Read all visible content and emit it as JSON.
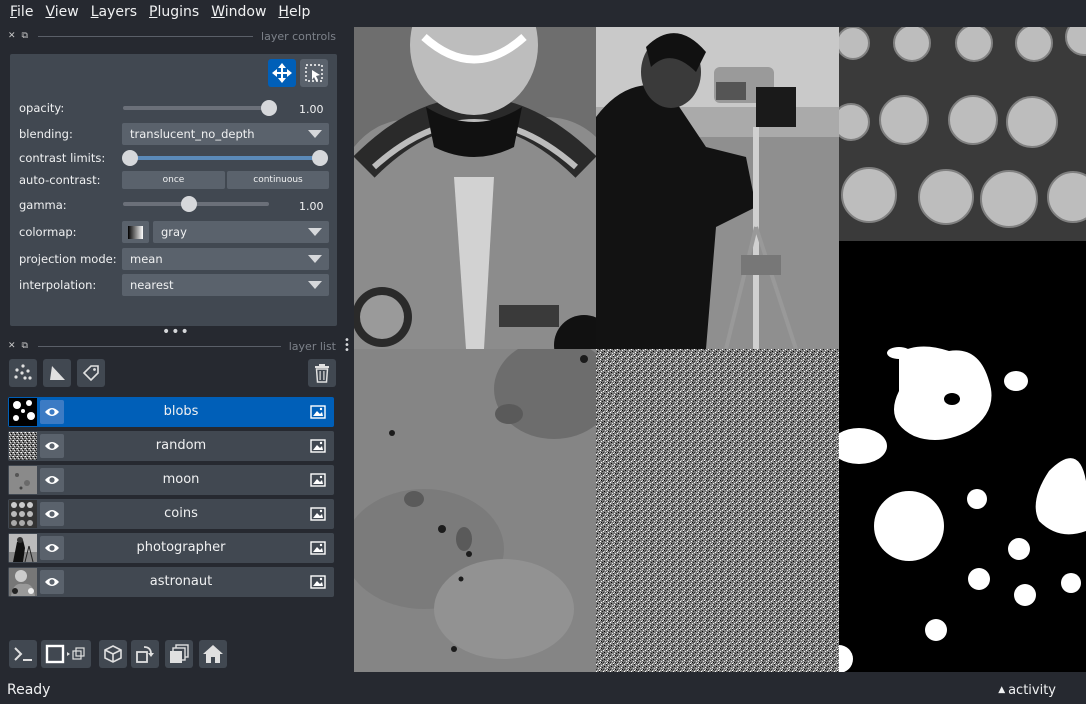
{
  "menu": [
    {
      "label": "File",
      "mnemonic": "F",
      "rest": "ile"
    },
    {
      "label": "View",
      "mnemonic": "V",
      "rest": "iew"
    },
    {
      "label": "Layers",
      "mnemonic": "L",
      "rest": "ayers"
    },
    {
      "label": "Plugins",
      "mnemonic": "P",
      "rest": "lugins"
    },
    {
      "label": "Window",
      "mnemonic": "W",
      "rest": "indow"
    },
    {
      "label": "Help",
      "mnemonic": "H",
      "rest": "elp"
    }
  ],
  "layer_controls": {
    "title": "layer controls",
    "opacity_label": "opacity:",
    "opacity_value": "1.00",
    "opacity_fraction": 1.0,
    "blending_label": "blending:",
    "blending_value": "translucent_no_depth",
    "contrast_label": "contrast limits:",
    "contrast_range": [
      0.0,
      1.0
    ],
    "auto_contrast_label": "auto-contrast:",
    "once_label": "once",
    "continuous_label": "continuous",
    "gamma_label": "gamma:",
    "gamma_value": "1.00",
    "gamma_fraction": 0.45,
    "colormap_label": "colormap:",
    "colormap_value": "gray",
    "projection_label": "projection mode:",
    "projection_value": "mean",
    "interpolation_label": "interpolation:",
    "interpolation_value": "nearest"
  },
  "layer_list": {
    "title": "layer list",
    "layers": [
      {
        "name": "blobs",
        "selected": true
      },
      {
        "name": "random",
        "selected": false
      },
      {
        "name": "moon",
        "selected": false
      },
      {
        "name": "coins",
        "selected": false
      },
      {
        "name": "photographer",
        "selected": false
      },
      {
        "name": "astronaut",
        "selected": false
      }
    ]
  },
  "icons": {
    "pan_zoom": "move-arrows-icon",
    "transform": "transform-icon",
    "new_points": "points-icon",
    "new_shapes": "shapes-icon",
    "new_labels": "labels-tag-icon",
    "delete": "trash-icon",
    "console": "console-icon",
    "ndisplay": "2d-3d-toggle-icon",
    "roll": "roll-icon",
    "transpose": "transpose-icon",
    "grid": "grid-icon",
    "home": "home-icon"
  },
  "accent_color": "#005fb8",
  "status": {
    "text": "Ready",
    "activity": "activity"
  }
}
